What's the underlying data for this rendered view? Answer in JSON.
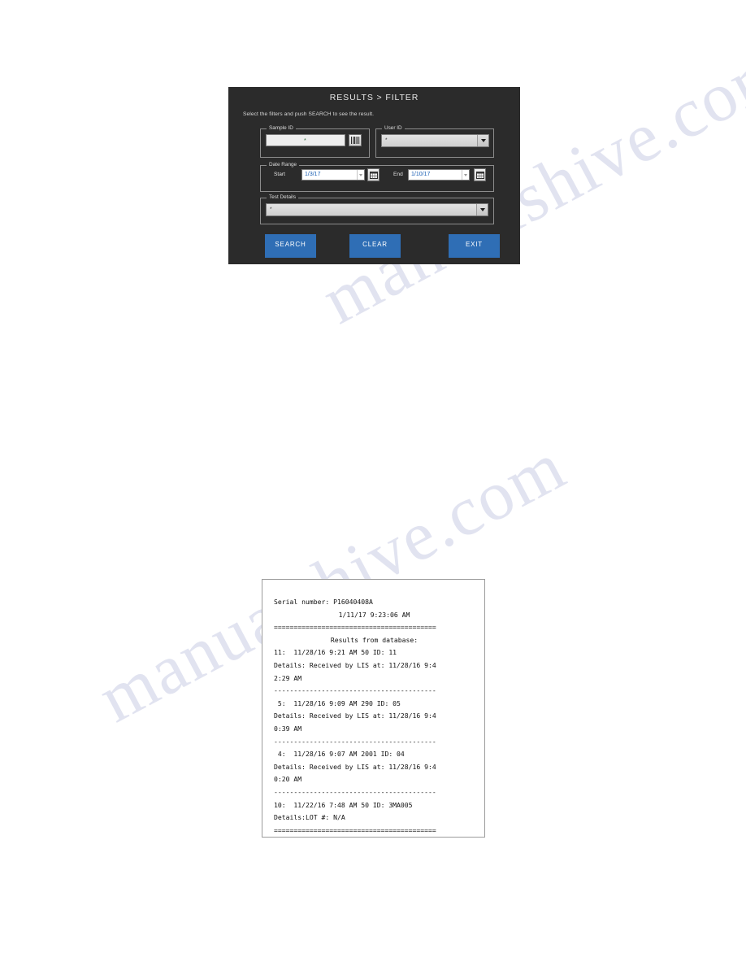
{
  "watermark": {
    "line1": "manualshive.com",
    "line2": "manualshive.com"
  },
  "filter_panel": {
    "title": "RESULTS > FILTER",
    "subtitle": "Select the filters and push SEARCH to see the result.",
    "background_color": "#2b2b2b",
    "accent_color": "#2f6eb5",
    "groups": {
      "sample_id": {
        "label": "Sample ID",
        "input_value": "*",
        "scan_icon": "barcode-icon"
      },
      "user_id": {
        "label": "User ID",
        "selected_value": "*",
        "arrow_icon": "chevron-down-icon"
      },
      "date_range": {
        "label": "Date Range",
        "start_label": "Start",
        "start_value": "1/3/17",
        "end_label": "End",
        "end_value": "1/10/17",
        "calendar_icon": "calendar-icon"
      },
      "test_details": {
        "label": "Test Details",
        "selected_value": "*",
        "arrow_icon": "chevron-down-icon"
      }
    },
    "buttons": {
      "search": "SEARCH",
      "clear": "CLEAR",
      "exit": "EXIT"
    }
  },
  "receipt": {
    "serial_line": "Serial number: P16040408A",
    "timestamp_line": "1/11/17 9:23:06 AM",
    "top_separator": "=========================================",
    "results_header": "Results from database:",
    "entries": [
      {
        "summary": "11:  11/28/16 9:21 AM 50 ID: 11",
        "details_1": "Details: Received by LIS at: 11/28/16 9:4",
        "details_2": "2:29 AM",
        "separator": "-----------------------------------------"
      },
      {
        "summary": " 5:  11/28/16 9:09 AM 290 ID: 05",
        "details_1": "Details: Received by LIS at: 11/28/16 9:4",
        "details_2": "0:39 AM",
        "separator": "-----------------------------------------"
      },
      {
        "summary": " 4:  11/28/16 9:07 AM 2001 ID: 04",
        "details_1": "Details: Received by LIS at: 11/28/16 9:4",
        "details_2": "0:20 AM",
        "separator": "-----------------------------------------"
      },
      {
        "summary": "10:  11/22/16 7:48 AM 50 ID: 3MA005",
        "details_1": "Details:LOT #: N/A",
        "details_2": "",
        "separator": ""
      }
    ],
    "bottom_separator": "========================================="
  }
}
